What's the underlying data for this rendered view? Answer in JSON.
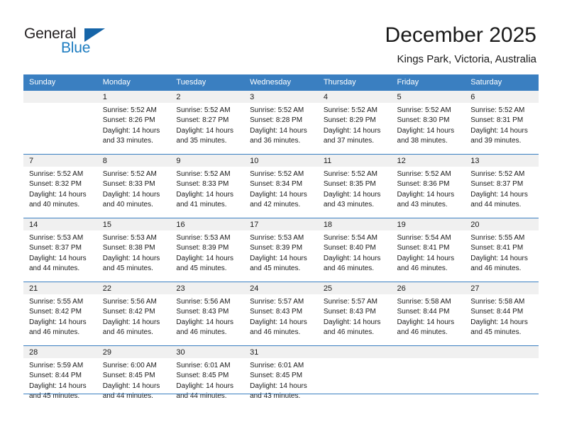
{
  "branding": {
    "name_top": "General",
    "name_bottom": "Blue",
    "triangle_color": "#1665a8",
    "blue_color": "#1c7cc0",
    "dark_color": "#231f20"
  },
  "header": {
    "title": "December 2025",
    "location": "Kings Park, Victoria, Australia"
  },
  "theme": {
    "header_bg": "#3a7fc1",
    "header_text": "#ffffff",
    "daynum_bg": "#f0f0f0",
    "grid_line": "#3a7fc1",
    "body_text": "#1a1a1a"
  },
  "weekdays": [
    "Sunday",
    "Monday",
    "Tuesday",
    "Wednesday",
    "Thursday",
    "Friday",
    "Saturday"
  ],
  "weeks": [
    [
      {
        "day": "",
        "lines": []
      },
      {
        "day": "1",
        "lines": [
          "Sunrise: 5:52 AM",
          "Sunset: 8:26 PM",
          "Daylight: 14 hours",
          "and 33 minutes."
        ]
      },
      {
        "day": "2",
        "lines": [
          "Sunrise: 5:52 AM",
          "Sunset: 8:27 PM",
          "Daylight: 14 hours",
          "and 35 minutes."
        ]
      },
      {
        "day": "3",
        "lines": [
          "Sunrise: 5:52 AM",
          "Sunset: 8:28 PM",
          "Daylight: 14 hours",
          "and 36 minutes."
        ]
      },
      {
        "day": "4",
        "lines": [
          "Sunrise: 5:52 AM",
          "Sunset: 8:29 PM",
          "Daylight: 14 hours",
          "and 37 minutes."
        ]
      },
      {
        "day": "5",
        "lines": [
          "Sunrise: 5:52 AM",
          "Sunset: 8:30 PM",
          "Daylight: 14 hours",
          "and 38 minutes."
        ]
      },
      {
        "day": "6",
        "lines": [
          "Sunrise: 5:52 AM",
          "Sunset: 8:31 PM",
          "Daylight: 14 hours",
          "and 39 minutes."
        ]
      }
    ],
    [
      {
        "day": "7",
        "lines": [
          "Sunrise: 5:52 AM",
          "Sunset: 8:32 PM",
          "Daylight: 14 hours",
          "and 40 minutes."
        ]
      },
      {
        "day": "8",
        "lines": [
          "Sunrise: 5:52 AM",
          "Sunset: 8:33 PM",
          "Daylight: 14 hours",
          "and 40 minutes."
        ]
      },
      {
        "day": "9",
        "lines": [
          "Sunrise: 5:52 AM",
          "Sunset: 8:33 PM",
          "Daylight: 14 hours",
          "and 41 minutes."
        ]
      },
      {
        "day": "10",
        "lines": [
          "Sunrise: 5:52 AM",
          "Sunset: 8:34 PM",
          "Daylight: 14 hours",
          "and 42 minutes."
        ]
      },
      {
        "day": "11",
        "lines": [
          "Sunrise: 5:52 AM",
          "Sunset: 8:35 PM",
          "Daylight: 14 hours",
          "and 43 minutes."
        ]
      },
      {
        "day": "12",
        "lines": [
          "Sunrise: 5:52 AM",
          "Sunset: 8:36 PM",
          "Daylight: 14 hours",
          "and 43 minutes."
        ]
      },
      {
        "day": "13",
        "lines": [
          "Sunrise: 5:52 AM",
          "Sunset: 8:37 PM",
          "Daylight: 14 hours",
          "and 44 minutes."
        ]
      }
    ],
    [
      {
        "day": "14",
        "lines": [
          "Sunrise: 5:53 AM",
          "Sunset: 8:37 PM",
          "Daylight: 14 hours",
          "and 44 minutes."
        ]
      },
      {
        "day": "15",
        "lines": [
          "Sunrise: 5:53 AM",
          "Sunset: 8:38 PM",
          "Daylight: 14 hours",
          "and 45 minutes."
        ]
      },
      {
        "day": "16",
        "lines": [
          "Sunrise: 5:53 AM",
          "Sunset: 8:39 PM",
          "Daylight: 14 hours",
          "and 45 minutes."
        ]
      },
      {
        "day": "17",
        "lines": [
          "Sunrise: 5:53 AM",
          "Sunset: 8:39 PM",
          "Daylight: 14 hours",
          "and 45 minutes."
        ]
      },
      {
        "day": "18",
        "lines": [
          "Sunrise: 5:54 AM",
          "Sunset: 8:40 PM",
          "Daylight: 14 hours",
          "and 46 minutes."
        ]
      },
      {
        "day": "19",
        "lines": [
          "Sunrise: 5:54 AM",
          "Sunset: 8:41 PM",
          "Daylight: 14 hours",
          "and 46 minutes."
        ]
      },
      {
        "day": "20",
        "lines": [
          "Sunrise: 5:55 AM",
          "Sunset: 8:41 PM",
          "Daylight: 14 hours",
          "and 46 minutes."
        ]
      }
    ],
    [
      {
        "day": "21",
        "lines": [
          "Sunrise: 5:55 AM",
          "Sunset: 8:42 PM",
          "Daylight: 14 hours",
          "and 46 minutes."
        ]
      },
      {
        "day": "22",
        "lines": [
          "Sunrise: 5:56 AM",
          "Sunset: 8:42 PM",
          "Daylight: 14 hours",
          "and 46 minutes."
        ]
      },
      {
        "day": "23",
        "lines": [
          "Sunrise: 5:56 AM",
          "Sunset: 8:43 PM",
          "Daylight: 14 hours",
          "and 46 minutes."
        ]
      },
      {
        "day": "24",
        "lines": [
          "Sunrise: 5:57 AM",
          "Sunset: 8:43 PM",
          "Daylight: 14 hours",
          "and 46 minutes."
        ]
      },
      {
        "day": "25",
        "lines": [
          "Sunrise: 5:57 AM",
          "Sunset: 8:43 PM",
          "Daylight: 14 hours",
          "and 46 minutes."
        ]
      },
      {
        "day": "26",
        "lines": [
          "Sunrise: 5:58 AM",
          "Sunset: 8:44 PM",
          "Daylight: 14 hours",
          "and 46 minutes."
        ]
      },
      {
        "day": "27",
        "lines": [
          "Sunrise: 5:58 AM",
          "Sunset: 8:44 PM",
          "Daylight: 14 hours",
          "and 45 minutes."
        ]
      }
    ],
    [
      {
        "day": "28",
        "lines": [
          "Sunrise: 5:59 AM",
          "Sunset: 8:44 PM",
          "Daylight: 14 hours",
          "and 45 minutes."
        ]
      },
      {
        "day": "29",
        "lines": [
          "Sunrise: 6:00 AM",
          "Sunset: 8:45 PM",
          "Daylight: 14 hours",
          "and 44 minutes."
        ]
      },
      {
        "day": "30",
        "lines": [
          "Sunrise: 6:01 AM",
          "Sunset: 8:45 PM",
          "Daylight: 14 hours",
          "and 44 minutes."
        ]
      },
      {
        "day": "31",
        "lines": [
          "Sunrise: 6:01 AM",
          "Sunset: 8:45 PM",
          "Daylight: 14 hours",
          "and 43 minutes."
        ]
      },
      {
        "day": "",
        "lines": []
      },
      {
        "day": "",
        "lines": []
      },
      {
        "day": "",
        "lines": []
      }
    ]
  ]
}
